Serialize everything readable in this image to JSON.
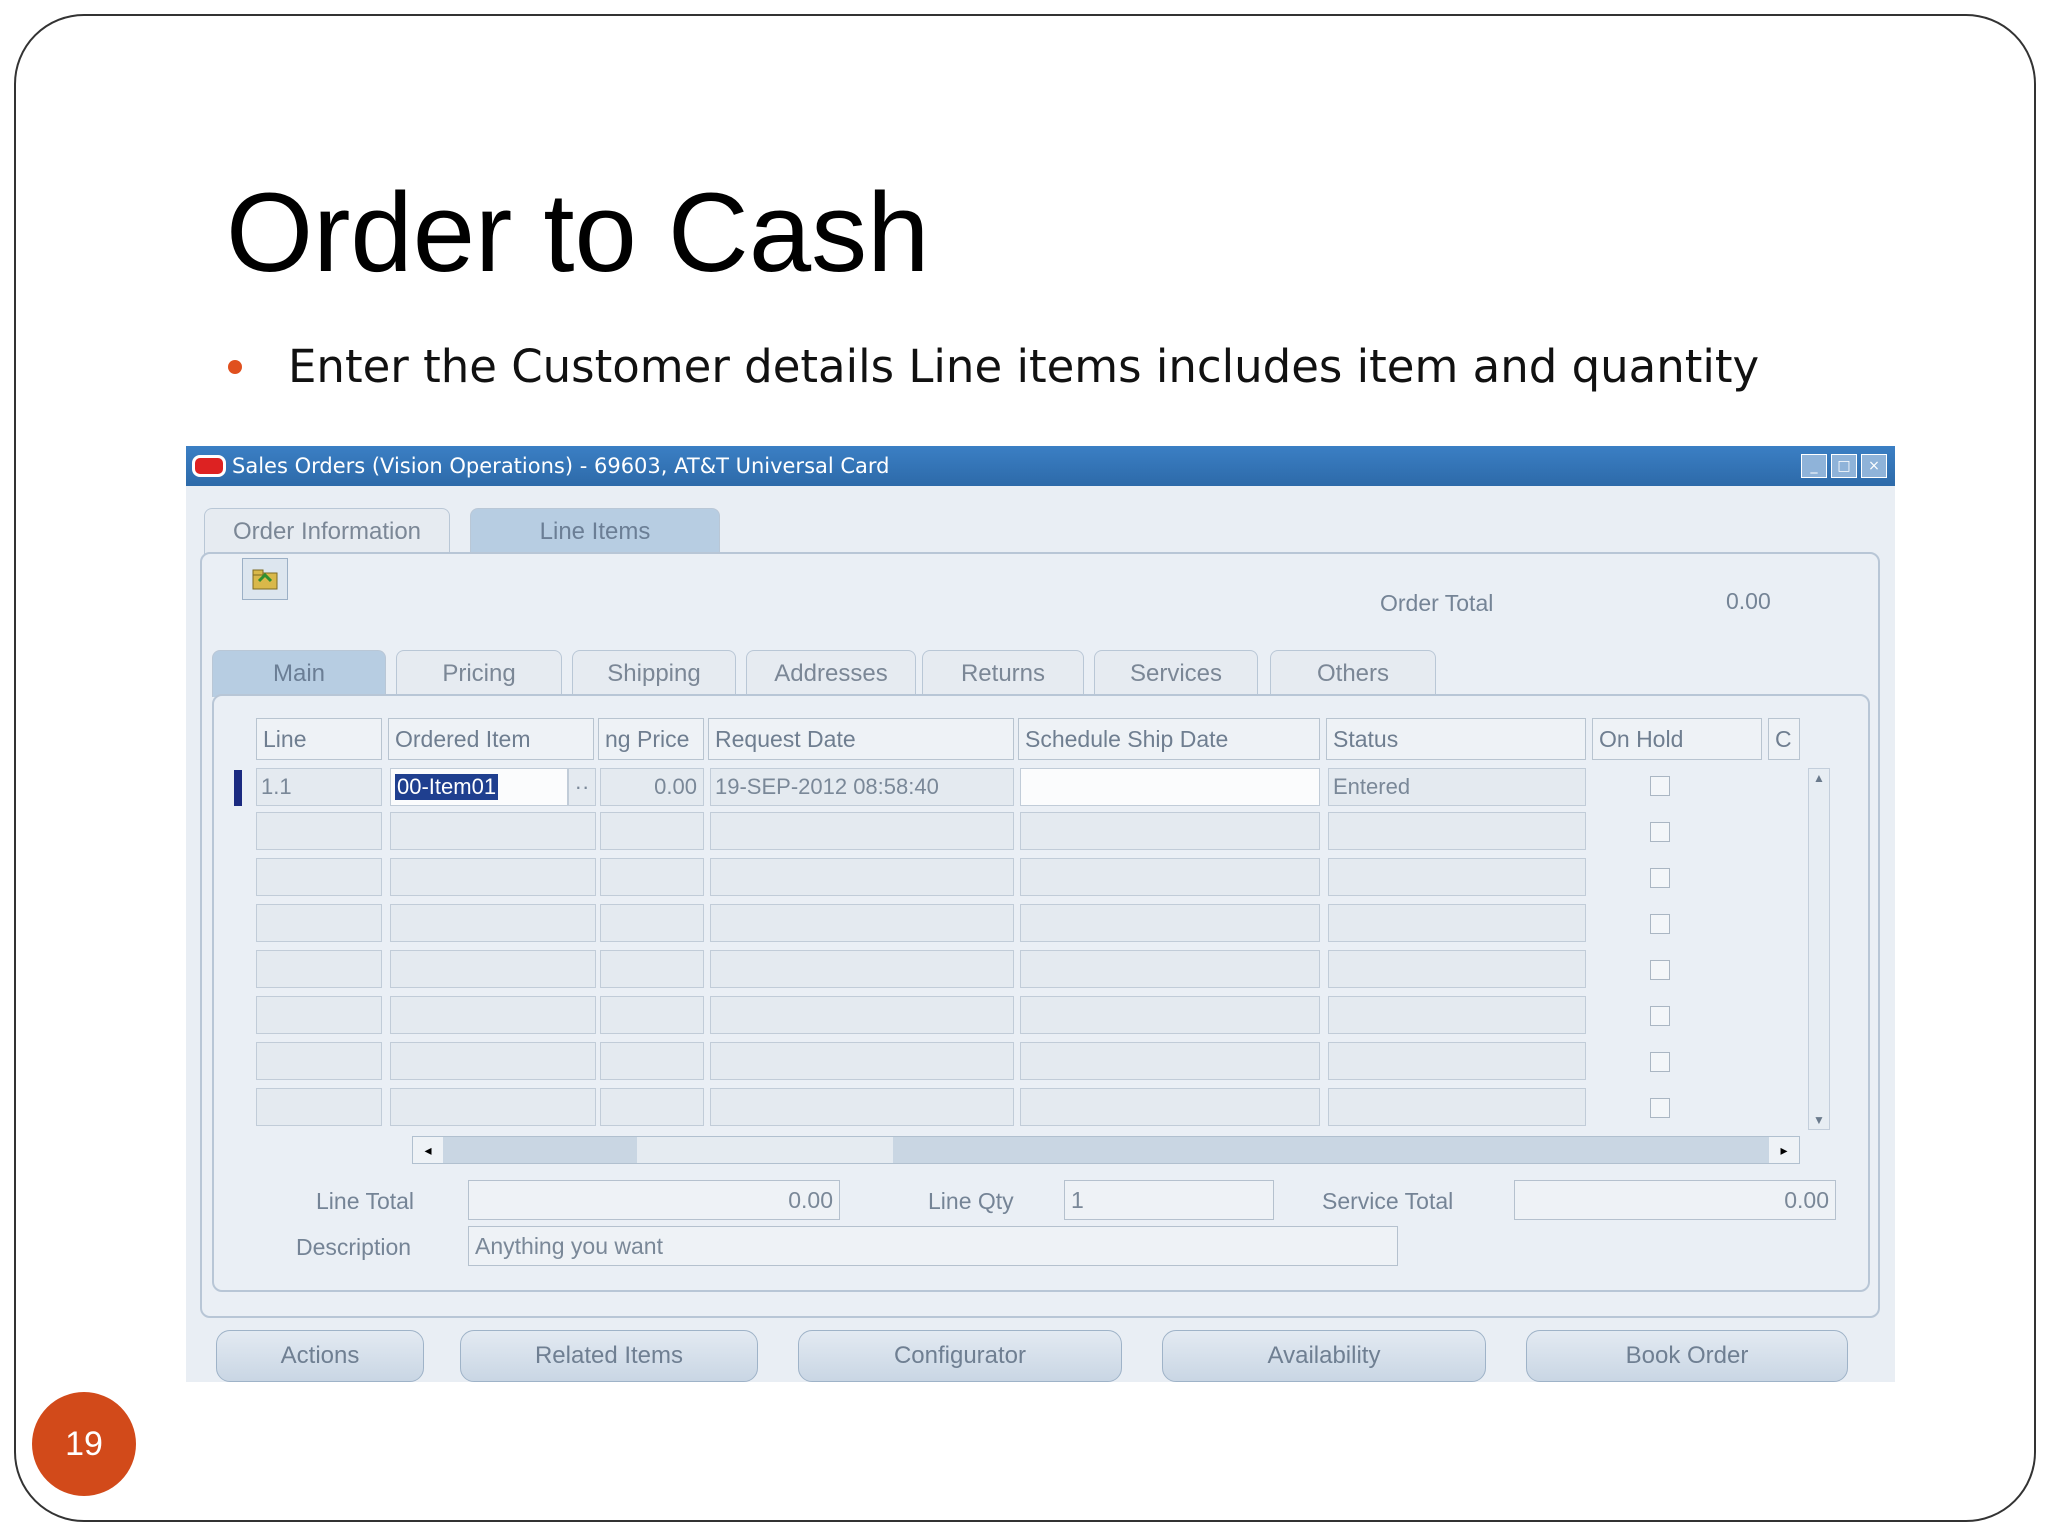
{
  "slide": {
    "title": "Order to Cash",
    "bullet": "Enter the Customer details  Line items  includes item and quantity",
    "page_number": "19"
  },
  "window": {
    "title": "Sales Orders (Vision Operations) - 69603, AT&T Universal Card",
    "tabs": [
      "Order Information",
      "Line Items"
    ],
    "active_tab": "Line Items",
    "order_total_label": "Order Total",
    "order_total_value": "0.00",
    "subtabs": [
      "Main",
      "Pricing",
      "Shipping",
      "Addresses",
      "Returns",
      "Services",
      "Others"
    ],
    "active_subtab": "Main",
    "columns": [
      "Line",
      "Ordered Item",
      "ng Price",
      "Request Date",
      "Schedule Ship Date",
      "Status",
      "On Hold",
      "C"
    ],
    "rows": [
      {
        "line": "1.1",
        "ordered_item": "00-Item01",
        "price": "0.00",
        "request_date": "19-SEP-2012 08:58:40",
        "schedule_ship_date": "",
        "status": "Entered"
      }
    ],
    "line_total_label": "Line Total",
    "line_total_value": "0.00",
    "line_qty_label": "Line Qty",
    "line_qty_value": "1",
    "service_total_label": "Service Total",
    "service_total_value": "0.00",
    "description_label": "Description",
    "description_value": "Anything you want",
    "buttons": [
      "Actions",
      "Related Items",
      "Configurator",
      "Availability",
      "Book Order"
    ]
  },
  "colors": {
    "accent": "#d24a1a",
    "titlebar": "#2d6aa9"
  }
}
